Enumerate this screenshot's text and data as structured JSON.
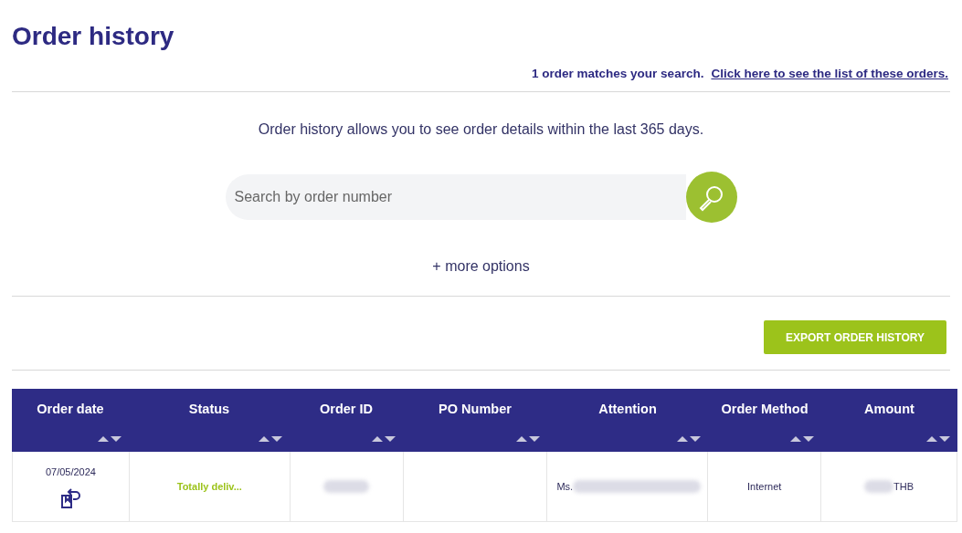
{
  "title": "Order history",
  "match": {
    "text": "1 order matches your search.",
    "link": "Click here to see the list of these orders."
  },
  "intro": "Order history allows you to see order details within the last 365 days.",
  "search": {
    "placeholder": "Search by order number"
  },
  "more_options": "+ more options",
  "export_button": "EXPORT ORDER HISTORY",
  "table": {
    "columns": [
      "Order date",
      "Status",
      "Order ID",
      "PO Number",
      "Attention",
      "Order Method",
      "Amount"
    ],
    "rows": [
      {
        "order_date": "07/05/2024",
        "status": "Totally deliv...",
        "attention": "Ms.",
        "order_method": "Internet",
        "amount": "THB"
      }
    ]
  }
}
